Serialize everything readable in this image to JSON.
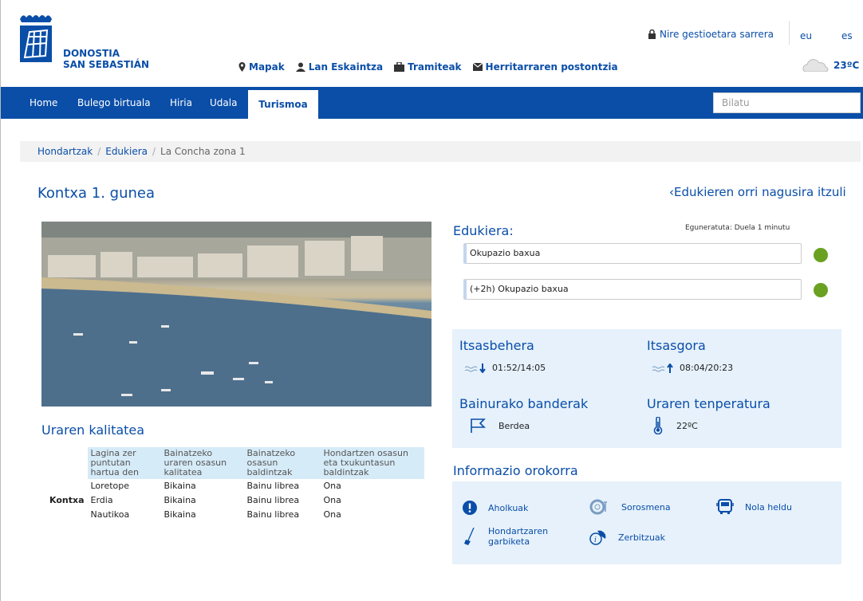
{
  "header": {
    "logo_line1": "DONOSTIA",
    "logo_line2": "SAN SEBASTIÁN",
    "login_label": "Nire gestioetara sarrera",
    "languages": [
      "eu",
      "es"
    ],
    "quick_links": [
      {
        "label": "Mapak",
        "icon": "map-pin-icon"
      },
      {
        "label": "Lan Eskaintza",
        "icon": "person-icon"
      },
      {
        "label": "Tramiteak",
        "icon": "briefcase-icon"
      },
      {
        "label": "Herritarraren postontzia",
        "icon": "mail-icon"
      }
    ],
    "weather_temp": "23ºC",
    "weather_icon": "cloud-icon"
  },
  "nav": {
    "items": [
      "Home",
      "Bulego birtuala",
      "Hiria",
      "Udala",
      "Turismoa"
    ],
    "active": "Turismoa",
    "search_placeholder": "Bilatu"
  },
  "breadcrumb": [
    "Hondartzak",
    "Edukiera",
    "La Concha zona 1"
  ],
  "page": {
    "title": "Kontxa 1. gunea",
    "back_link": "Edukieren orri nagusira itzuli"
  },
  "occupancy": {
    "title": "Edukiera:",
    "updated": "Eguneratuta: Duela 1 minutu",
    "rows": [
      {
        "label": "Okupazio baxua",
        "status_color": "#6aa121"
      },
      {
        "label": "(+2h) Okupazio baxua",
        "status_color": "#6aa121"
      }
    ]
  },
  "tides": {
    "low_title": "Itsasbehera",
    "low_value": "01:52/14:05",
    "high_title": "Itsasgora",
    "high_value": "08:04/20:23",
    "flags_title": "Bainurako banderak",
    "flags_value": "Berdea",
    "temp_title": "Uraren tenperatura",
    "temp_value": "22ºC"
  },
  "water_quality": {
    "title": "Uraren kalitatea",
    "headers": [
      "Lagina zer puntutan hartua den",
      "Bainatzeko uraren osasun kalitatea",
      "Bainatzeko osasun baldintzak",
      "Hondartzen osasun eta txukuntasun baldintzak"
    ],
    "row_label": "Kontxa",
    "rows": [
      [
        "Loretope",
        "Bikaina",
        "Bainu librea",
        "Ona"
      ],
      [
        "Erdia",
        "Bikaina",
        "Bainu librea",
        "Ona"
      ],
      [
        "Nautikoa",
        "Bikaina",
        "Bainu librea",
        "Ona"
      ]
    ]
  },
  "info": {
    "title": "Informazio orokorra",
    "items": [
      {
        "label": "Aholkuak",
        "icon": "alert-icon"
      },
      {
        "label": "Sorosmena",
        "icon": "lifebuoy-icon"
      },
      {
        "label": "Nola heldu",
        "icon": "bus-icon"
      },
      {
        "label": "Hondartzaren garbiketa",
        "icon": "broom-icon"
      },
      {
        "label": "Zerbitzuak",
        "icon": "info-icon"
      }
    ]
  }
}
